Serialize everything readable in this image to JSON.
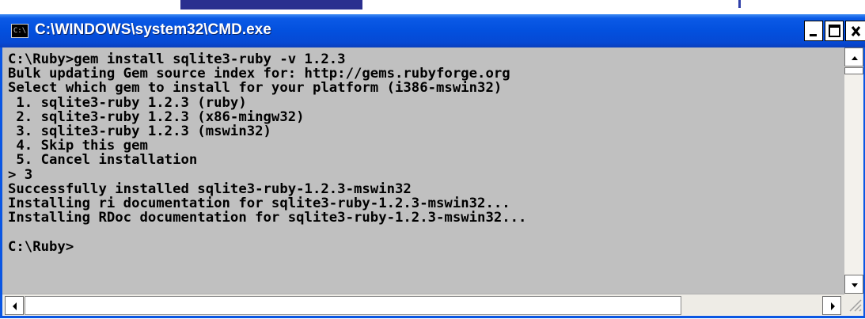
{
  "window": {
    "title": "C:\\WINDOWS\\system32\\CMD.exe",
    "icon": "cmd-icon",
    "icon_glyph": "C:\\",
    "title_bar_color": "#0350de",
    "console_background": "#c0c0c0",
    "console_text_color": "#000000"
  },
  "console": {
    "lines": [
      "C:\\Ruby>gem install sqlite3-ruby -v 1.2.3",
      "Bulk updating Gem source index for: http://gems.rubyforge.org",
      "Select which gem to install for your platform (i386-mswin32)",
      " 1. sqlite3-ruby 1.2.3 (ruby)",
      " 2. sqlite3-ruby 1.2.3 (x86-mingw32)",
      " 3. sqlite3-ruby 1.2.3 (mswin32)",
      " 4. Skip this gem",
      " 5. Cancel installation",
      "> 3",
      "Successfully installed sqlite3-ruby-1.2.3-mswin32",
      "Installing ri documentation for sqlite3-ruby-1.2.3-mswin32...",
      "Installing RDoc documentation for sqlite3-ruby-1.2.3-mswin32...",
      "",
      "C:\\Ruby>"
    ]
  },
  "controls": {
    "minimize_icon": "minimize-icon",
    "maximize_icon": "maximize-icon",
    "close_icon": "close-icon"
  }
}
